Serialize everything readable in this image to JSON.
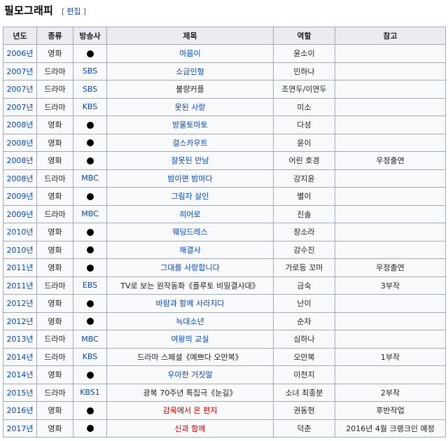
{
  "section": {
    "title": "필모그래피",
    "edit_open": "[",
    "edit_label": "편집",
    "edit_close": "]"
  },
  "table": {
    "headers": [
      "년도",
      "종류",
      "방송사",
      "제목",
      "역할",
      "참고"
    ],
    "rows": [
      {
        "year": "2006년",
        "kind": "영화",
        "broadcaster": "●",
        "title": "마음이",
        "title_style": "link",
        "role": "윤소이",
        "note": ""
      },
      {
        "year": "2007년",
        "kind": "드라마",
        "broadcaster": "SBS",
        "title": "소금인형",
        "title_style": "link",
        "role": "민하나",
        "note": ""
      },
      {
        "year": "2007년",
        "kind": "드라마",
        "broadcaster": "SBS",
        "title": "불량커플",
        "title_style": "plain",
        "role": "조연두/이연두",
        "note": ""
      },
      {
        "year": "2007년",
        "kind": "드라마",
        "broadcaster": "KBS",
        "title": "못된 사랑",
        "title_style": "link",
        "role": "미소",
        "note": ""
      },
      {
        "year": "2008년",
        "kind": "영화",
        "broadcaster": "●",
        "title": "방울토마토",
        "title_style": "link",
        "role": "다성",
        "note": ""
      },
      {
        "year": "2008년",
        "kind": "영화",
        "broadcaster": "●",
        "title": "걸스카우트",
        "title_style": "link",
        "role": "윤이",
        "note": ""
      },
      {
        "year": "2008년",
        "kind": "영화",
        "broadcaster": "●",
        "title": "잘못된 만남",
        "title_style": "link",
        "role": "어린 호경",
        "note": "우정출연"
      },
      {
        "year": "2008년",
        "kind": "드라마",
        "broadcaster": "MBC",
        "title": "밤이면 밤마다",
        "title_style": "link",
        "role": "강지윤",
        "note": ""
      },
      {
        "year": "2009년",
        "kind": "영화",
        "broadcaster": "●",
        "title": "그림자 살인",
        "title_style": "link",
        "role": "별이",
        "note": ""
      },
      {
        "year": "2009년",
        "kind": "드라마",
        "broadcaster": "MBC",
        "title": "히어로",
        "title_style": "link",
        "role": "진솔",
        "note": ""
      },
      {
        "year": "2010년",
        "kind": "영화",
        "broadcaster": "●",
        "title": "웨딩드레스",
        "title_style": "link",
        "role": "장소라",
        "note": ""
      },
      {
        "year": "2010년",
        "kind": "영화",
        "broadcaster": "●",
        "title": "해결사",
        "title_style": "link",
        "role": "강수진",
        "note": ""
      },
      {
        "year": "2011년",
        "kind": "영화",
        "broadcaster": "●",
        "title": "그대를 사랑합니다",
        "title_style": "link",
        "role": "가로등 꼬마",
        "note": "우정출연"
      },
      {
        "year": "2011년",
        "kind": "드라마",
        "broadcaster": "EBS",
        "title": "TV로 보는 원작동화《플루토 비밀결사대》",
        "title_style": "plain",
        "role": "금숙",
        "note": "3부작"
      },
      {
        "year": "2012년",
        "kind": "영화",
        "broadcaster": "●",
        "title": "바람과 함께 사라지다",
        "title_style": "link",
        "role": "난이",
        "note": ""
      },
      {
        "year": "2012년",
        "kind": "영화",
        "broadcaster": "●",
        "title": "늑대소년",
        "title_style": "link",
        "role": "순자",
        "note": ""
      },
      {
        "year": "2013년",
        "kind": "드라마",
        "broadcaster": "MBC",
        "title": "여왕의 교실",
        "title_style": "link",
        "role": "심하나",
        "note": ""
      },
      {
        "year": "2014년",
        "kind": "드라마",
        "broadcaster": "KBS",
        "title": "드라마 스페셜《예쁘다 오만복》",
        "title_style": "plain",
        "role": "오만복",
        "note": "1부작"
      },
      {
        "year": "2014년",
        "kind": "영화",
        "broadcaster": "●",
        "title": "우아한 거짓말",
        "title_style": "link",
        "role": "이천지",
        "note": ""
      },
      {
        "year": "2015년",
        "kind": "드라마",
        "broadcaster": "KBS1",
        "title": "광복 70주년 특집극《눈길》",
        "title_style": "plain",
        "role": "소녀 최종분",
        "note": "2부작"
      },
      {
        "year": "2016년",
        "kind": "영화",
        "broadcaster": "●",
        "title": "감옥에서 온 편지",
        "title_style": "red",
        "role": "권동현",
        "note": "후반작업"
      },
      {
        "year": "2017년",
        "kind": "영화",
        "broadcaster": "●",
        "title": "신과 함께",
        "title_style": "red",
        "role": "덕춘",
        "note": "2016년 4월 크랭크인 예정"
      }
    ]
  },
  "colors": {
    "link": "#0645ad",
    "redlink": "#ba0000",
    "header_bg": "#eaecf0",
    "cell_bg": "#f8f9fa",
    "border": "#a2a9b1"
  }
}
